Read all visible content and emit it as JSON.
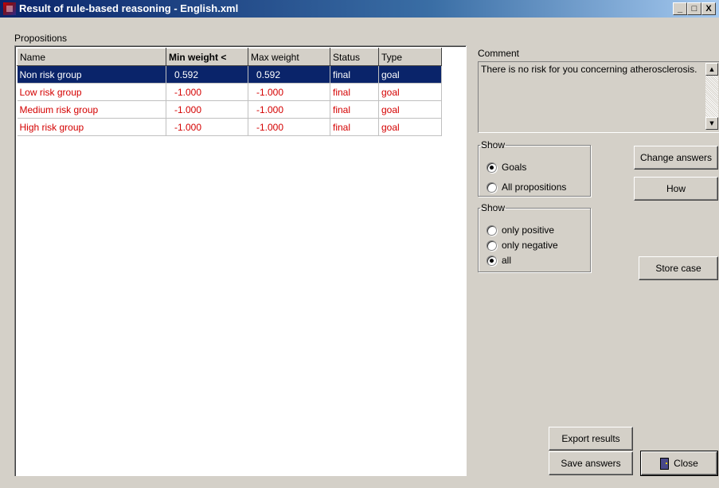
{
  "window": {
    "title": "Result of rule-based reasoning - English.xml",
    "controls": [
      "_",
      "□",
      "X"
    ]
  },
  "propositions": {
    "label": "Propositions",
    "columns": [
      "Name",
      "Min weight <",
      "Max weight",
      "Status",
      "Type"
    ],
    "rows": [
      {
        "name": "Non risk group",
        "min": "0.592",
        "max": "0.592",
        "status": "final",
        "type": "goal",
        "selected": true
      },
      {
        "name": "Low risk group",
        "min": "-1.000",
        "max": "-1.000",
        "status": "final",
        "type": "goal",
        "selected": false
      },
      {
        "name": "Medium risk group",
        "min": "-1.000",
        "max": "-1.000",
        "status": "final",
        "type": "goal",
        "selected": false
      },
      {
        "name": "High risk group",
        "min": "-1.000",
        "max": "-1.000",
        "status": "final",
        "type": "goal",
        "selected": false
      }
    ]
  },
  "comment": {
    "label": "Comment",
    "text": "There is no risk for you concerning atherosclerosis."
  },
  "show_group1": {
    "legend": "Show",
    "options": [
      "Goals",
      "All propositions"
    ],
    "selected": "Goals"
  },
  "show_group2": {
    "legend": "Show",
    "options": [
      "only positive",
      "only negative",
      "all"
    ],
    "selected": "all"
  },
  "buttons": {
    "change_answers": "Change answers",
    "how": "How",
    "store_case": "Store case",
    "export_results": "Export results",
    "save_answers": "Save answers",
    "close": "Close"
  },
  "colors": {
    "title_bar": "#0a246a",
    "selection": "#0a246a",
    "row_text": "#d40000",
    "face": "#d4d0c8"
  }
}
